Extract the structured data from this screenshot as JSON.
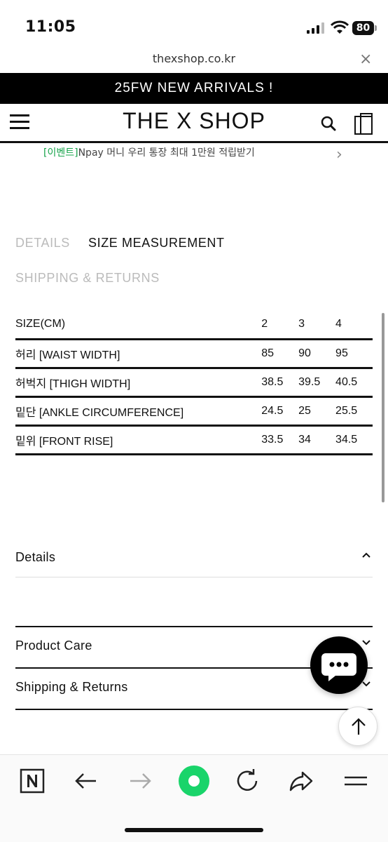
{
  "status_bar": {
    "time": "11:05",
    "battery": "80"
  },
  "browser": {
    "url": "thexshop.co.kr",
    "close_glyph": "×"
  },
  "promo_banner": "25FW NEW ARRIVALS !",
  "header": {
    "logo": "THE X SHOP"
  },
  "event": {
    "tag": "[이벤트]",
    "text": "Npay 머니 우리 통장 최대 1만원 적립받기"
  },
  "tabs": {
    "details": "DETAILS",
    "size": "SIZE MEASUREMENT",
    "shipping": "SHIPPING & RETURNS"
  },
  "size_table": {
    "header": [
      "SIZE(CM)",
      "2",
      "3",
      "4"
    ],
    "rows": [
      [
        "허리 [WAIST WIDTH]",
        "85",
        "90",
        "95"
      ],
      [
        "허벅지 [THIGH WIDTH]",
        "38.5",
        "39.5",
        "40.5"
      ],
      [
        "밑단 [ANKLE CIRCUMFERENCE]",
        "24.5",
        "25",
        "25.5"
      ],
      [
        "밑위 [FRONT RISE]",
        "33.5",
        "34",
        "34.5"
      ]
    ]
  },
  "accordions": {
    "details": "Details",
    "product_care": "Product Care",
    "shipping": "Shipping & Returns"
  },
  "icons": {
    "menu": "hamburger-icon",
    "search": "search-icon",
    "cart": "shopping-bag-icon",
    "chat": "chat-bubble-icon",
    "top": "arrow-up-icon",
    "toolbar": [
      "naver-icon",
      "back-arrow-icon",
      "forward-arrow-icon",
      "green-dot-icon",
      "refresh-icon",
      "share-icon",
      "menu-icon"
    ]
  },
  "colors": {
    "event_tag": "#16a34a",
    "toolbar_accent": "#19d46a",
    "inactive_tab": "#bbbbbb"
  }
}
